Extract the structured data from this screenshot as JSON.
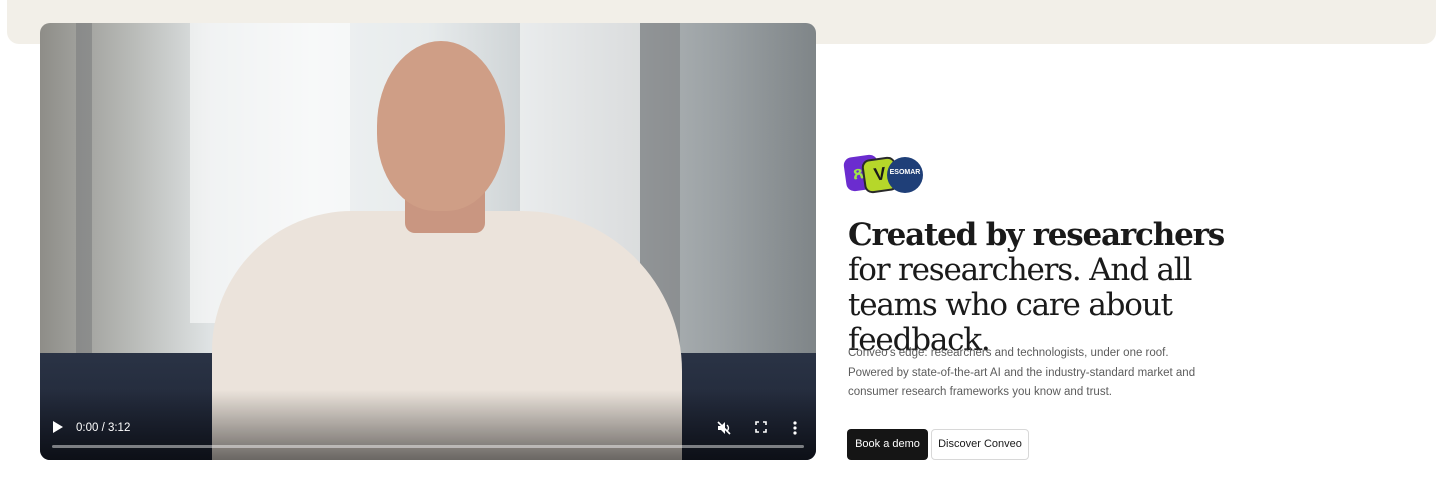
{
  "video": {
    "time": "0:00 / 3:12",
    "progress": 0,
    "controls": {
      "play_icon": "play-icon",
      "mute_icon": "muted-speaker-icon",
      "fullscreen_icon": "fullscreen-icon",
      "more_icon": "more-vertical-icon"
    }
  },
  "badges": [
    "badge-1",
    "badge-2",
    "ESOMAR"
  ],
  "headline": {
    "bold": "Created by researchers",
    "rest": " for researchers. And all teams who care about feedback."
  },
  "description": {
    "line1": "Conveo's edge: researchers and technologists, under one roof.",
    "line2": "Powered by state-of-the-art AI and the industry-standard market and",
    "line3": "consumer research frameworks you know and trust."
  },
  "buttons": {
    "primary": "Book a demo",
    "secondary": "Discover Conveo"
  },
  "colors": {
    "band": "#f2efe8",
    "primary_button": "#151515",
    "text": "#1a1a1a",
    "muted_text": "#5c5c5c"
  }
}
